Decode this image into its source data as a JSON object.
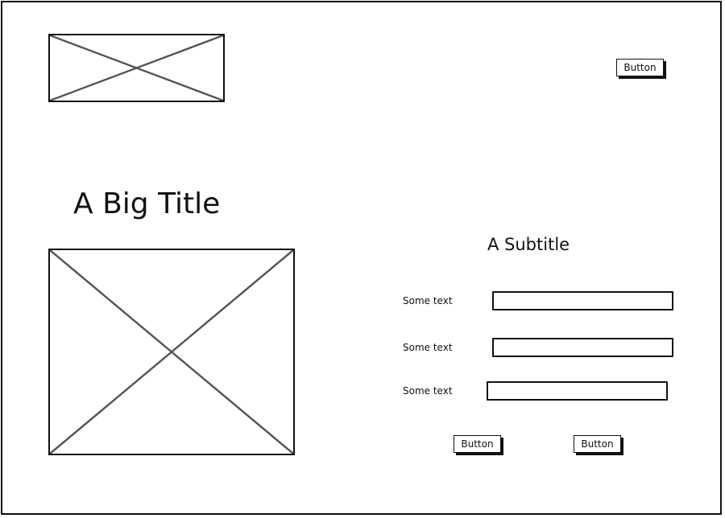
{
  "header": {
    "logo_icon": "image-placeholder-icon",
    "button_label": "Button"
  },
  "hero": {
    "title": "A Big Title",
    "image_icon": "image-placeholder-icon"
  },
  "form": {
    "subtitle": "A Subtitle",
    "fields": [
      {
        "label": "Some text",
        "value": ""
      },
      {
        "label": "Some text",
        "value": ""
      },
      {
        "label": "Some text",
        "value": ""
      }
    ],
    "buttons": [
      {
        "label": "Button"
      },
      {
        "label": "Button"
      }
    ]
  },
  "colors": {
    "stroke": "#111111",
    "placeholder_cross": "#555555",
    "background": "#ffffff"
  }
}
